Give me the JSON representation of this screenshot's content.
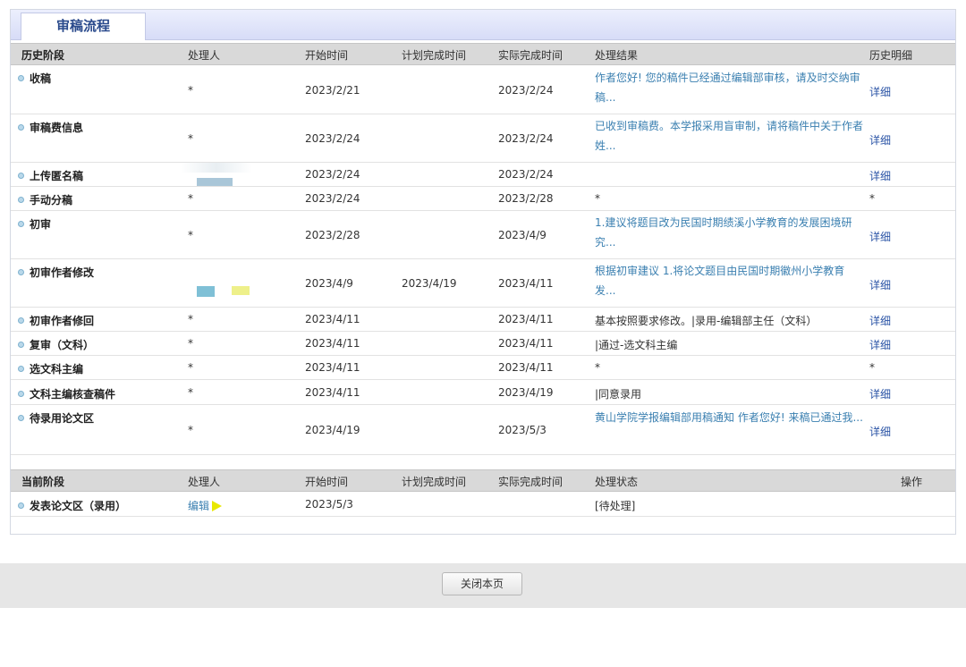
{
  "tab": {
    "title": "审稿流程"
  },
  "history": {
    "headers": [
      "历史阶段",
      "处理人",
      "开始时间",
      "计划完成时间",
      "实际完成时间",
      "处理结果",
      "历史明细"
    ],
    "rows": [
      {
        "stage": "收稿",
        "handler": "*",
        "start": "2023/2/21",
        "planned": "",
        "actual": "2023/2/24",
        "result": "作者您好! 您的稿件已经通过编辑部审核，请及时交纳审稿...",
        "result_style": "link",
        "detail": "详细"
      },
      {
        "stage": "审稿费信息",
        "handler": "*",
        "start": "2023/2/24",
        "planned": "",
        "actual": "2023/2/24",
        "result": "已收到审稿费。本学报采用盲审制，请将稿件中关于作者姓...",
        "result_style": "link",
        "detail": "详细"
      },
      {
        "stage": "上传匿名稿",
        "handler": "",
        "start": "2023/2/24",
        "planned": "",
        "actual": "2023/2/24",
        "result": "",
        "result_style": "plain",
        "detail": "详细"
      },
      {
        "stage": "手动分稿",
        "handler": "*",
        "start": "2023/2/24",
        "planned": "",
        "actual": "2023/2/28",
        "result": "*",
        "result_style": "plain",
        "detail": "*"
      },
      {
        "stage": "初审",
        "handler": "*",
        "start": "2023/2/28",
        "planned": "",
        "actual": "2023/4/9",
        "result": "1.建议将题目改为民国时期绩溪小学教育的发展困境研究...",
        "result_style": "link",
        "detail": "详细"
      },
      {
        "stage": "初审作者修改",
        "handler": "",
        "start": "2023/4/9",
        "planned": "2023/4/19",
        "actual": "2023/4/11",
        "result": "根据初审建议 1.将论文题目由民国时期徽州小学教育发...",
        "result_style": "link",
        "detail": "详细"
      },
      {
        "stage": "初审作者修回",
        "handler": "*",
        "start": "2023/4/11",
        "planned": "",
        "actual": "2023/4/11",
        "result": "基本按照要求修改。|录用-编辑部主任（文科）",
        "result_style": "plain",
        "detail": "详细"
      },
      {
        "stage": "复审（文科）",
        "handler": "*",
        "start": "2023/4/11",
        "planned": "",
        "actual": "2023/4/11",
        "result": "|通过-选文科主编",
        "result_style": "plain",
        "detail": "详细"
      },
      {
        "stage": "选文科主编",
        "handler": "*",
        "start": "2023/4/11",
        "planned": "",
        "actual": "2023/4/11",
        "result": "*",
        "result_style": "plain",
        "detail": "*"
      },
      {
        "stage": "文科主编核查稿件",
        "handler": "*",
        "start": "2023/4/11",
        "planned": "",
        "actual": "2023/4/19",
        "result": "|同意录用",
        "result_style": "plain",
        "detail": "详细"
      },
      {
        "stage": "待录用论文区",
        "handler": "*",
        "start": "2023/4/19",
        "planned": "",
        "actual": "2023/5/3",
        "result": "黄山学院学报编辑部用稿通知 作者您好! 来稿已通过我...",
        "result_style": "link",
        "detail": "详细"
      }
    ]
  },
  "current": {
    "headers": [
      "当前阶段",
      "处理人",
      "开始时间",
      "计划完成时间",
      "实际完成时间",
      "处理状态",
      "操作"
    ],
    "row": {
      "stage": "发表论文区（录用）",
      "handler": "编辑",
      "start": "2023/5/3",
      "planned": "",
      "actual": "",
      "status": "[待处理]"
    }
  },
  "footer": {
    "close_label": "关闭本页"
  },
  "colors": {
    "link": "#3a7fb0",
    "detail_link": "#2b54a6",
    "header_bg": "#d9d9d9",
    "tab_text": "#2a4a8c"
  }
}
